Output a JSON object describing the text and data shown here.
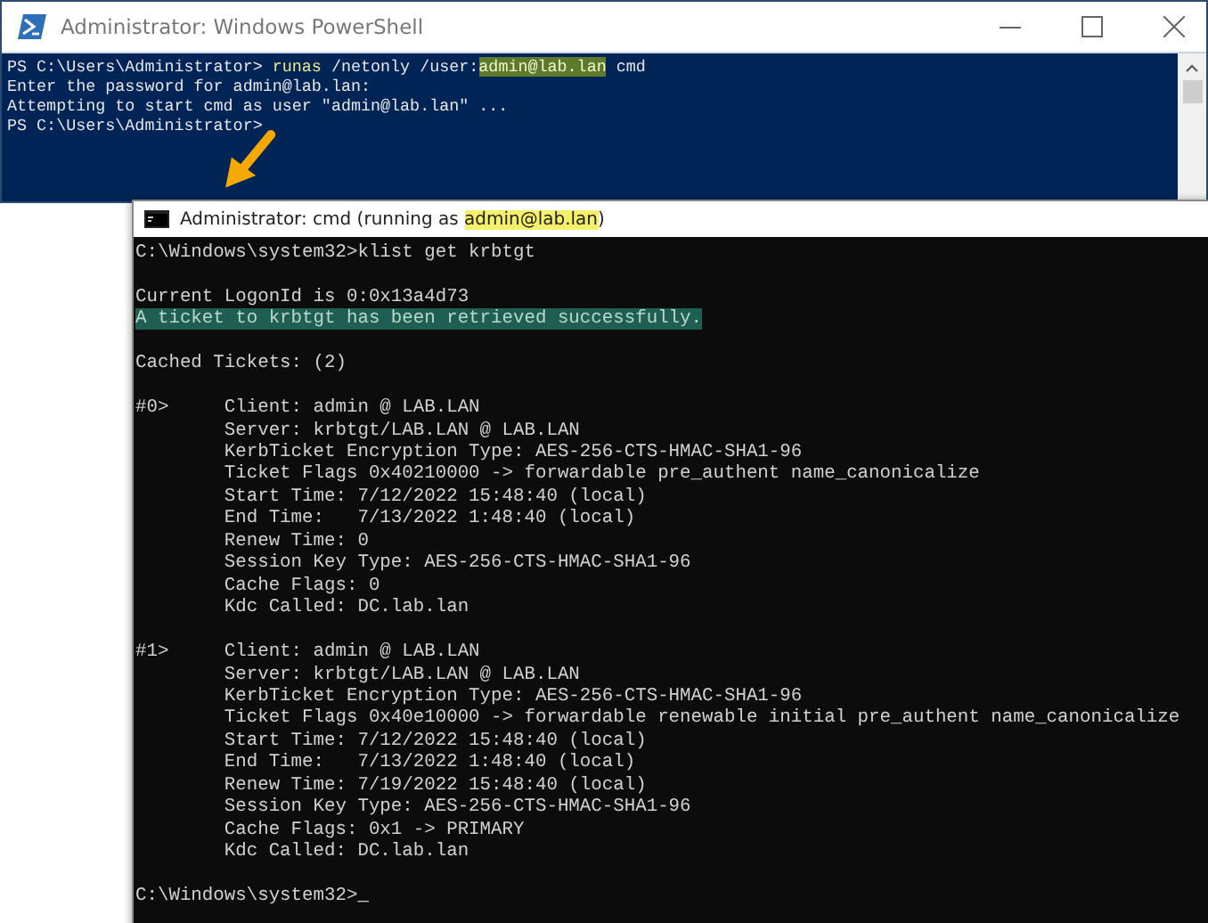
{
  "powershell_window": {
    "title": "Administrator: Windows PowerShell",
    "lines": [
      [
        {
          "text": "PS C:\\Users\\Administrator> ",
          "kind": "plain"
        },
        {
          "text": "runas",
          "kind": "keyword"
        },
        {
          "text": " /netonly /user:",
          "kind": "plain"
        },
        {
          "text": "admin@lab.lan",
          "kind": "mark"
        },
        {
          "text": " cmd",
          "kind": "plain"
        }
      ],
      [
        {
          "text": "Enter the password for admin@lab.lan:",
          "kind": "plain"
        }
      ],
      [
        {
          "text": "Attempting to start cmd as user \"admin@lab.lan\" ...",
          "kind": "plain"
        }
      ],
      [
        {
          "text": "PS C:\\Users\\Administrator>",
          "kind": "plain"
        }
      ]
    ]
  },
  "cmd_window": {
    "title": [
      {
        "text": "Administrator: cmd (running as ",
        "kind": "plain"
      },
      {
        "text": "admin@lab.lan",
        "kind": "mark"
      },
      {
        "text": ")",
        "kind": "plain"
      }
    ],
    "blocks": [
      [
        [
          {
            "text": "C:\\Windows\\system32>klist get krbtgt",
            "kind": "plain"
          }
        ]
      ],
      [
        [
          {
            "text": "Current LogonId is 0:0x13a4d73",
            "kind": "plain"
          }
        ],
        [
          {
            "text": "A ticket to krbtgt has been retrieved successfully.",
            "kind": "mark"
          }
        ]
      ],
      [
        [
          {
            "text": "Cached Tickets: (2)",
            "kind": "plain"
          }
        ]
      ],
      [
        [
          {
            "text": "#0>     Client: admin @ LAB.LAN",
            "kind": "plain"
          }
        ],
        [
          {
            "text": "        Server: krbtgt/LAB.LAN @ LAB.LAN",
            "kind": "plain"
          }
        ],
        [
          {
            "text": "        KerbTicket Encryption Type: AES-256-CTS-HMAC-SHA1-96",
            "kind": "plain"
          }
        ],
        [
          {
            "text": "        Ticket Flags 0x40210000 -> forwardable pre_authent name_canonicalize",
            "kind": "plain"
          }
        ],
        [
          {
            "text": "        Start Time: 7/12/2022 15:48:40 (local)",
            "kind": "plain"
          }
        ],
        [
          {
            "text": "        End Time:   7/13/2022 1:48:40 (local)",
            "kind": "plain"
          }
        ],
        [
          {
            "text": "        Renew Time: 0",
            "kind": "plain"
          }
        ],
        [
          {
            "text": "        Session Key Type: AES-256-CTS-HMAC-SHA1-96",
            "kind": "plain"
          }
        ],
        [
          {
            "text": "        Cache Flags: 0",
            "kind": "plain"
          }
        ],
        [
          {
            "text": "        Kdc Called: DC.lab.lan",
            "kind": "plain"
          }
        ]
      ],
      [
        [
          {
            "text": "#1>     Client: admin @ LAB.LAN",
            "kind": "plain"
          }
        ],
        [
          {
            "text": "        Server: krbtgt/LAB.LAN @ LAB.LAN",
            "kind": "plain"
          }
        ],
        [
          {
            "text": "        KerbTicket Encryption Type: AES-256-CTS-HMAC-SHA1-96",
            "kind": "plain"
          }
        ],
        [
          {
            "text": "        Ticket Flags 0x40e10000 -> forwardable renewable initial pre_authent name_canonicalize",
            "kind": "plain"
          }
        ],
        [
          {
            "text": "        Start Time: 7/12/2022 15:48:40 (local)",
            "kind": "plain"
          }
        ],
        [
          {
            "text": "        End Time:   7/13/2022 1:48:40 (local)",
            "kind": "plain"
          }
        ],
        [
          {
            "text": "        Renew Time: 7/19/2022 15:48:40 (local)",
            "kind": "plain"
          }
        ],
        [
          {
            "text": "        Session Key Type: AES-256-CTS-HMAC-SHA1-96",
            "kind": "plain"
          }
        ],
        [
          {
            "text": "        Cache Flags: 0x1 -> PRIMARY",
            "kind": "plain"
          }
        ],
        [
          {
            "text": "        Kdc Called: DC.lab.lan",
            "kind": "plain"
          }
        ]
      ],
      [
        [
          {
            "text": "C:\\Windows\\system32>",
            "kind": "plain"
          },
          {
            "text": "_",
            "kind": "cursor"
          }
        ]
      ]
    ]
  }
}
